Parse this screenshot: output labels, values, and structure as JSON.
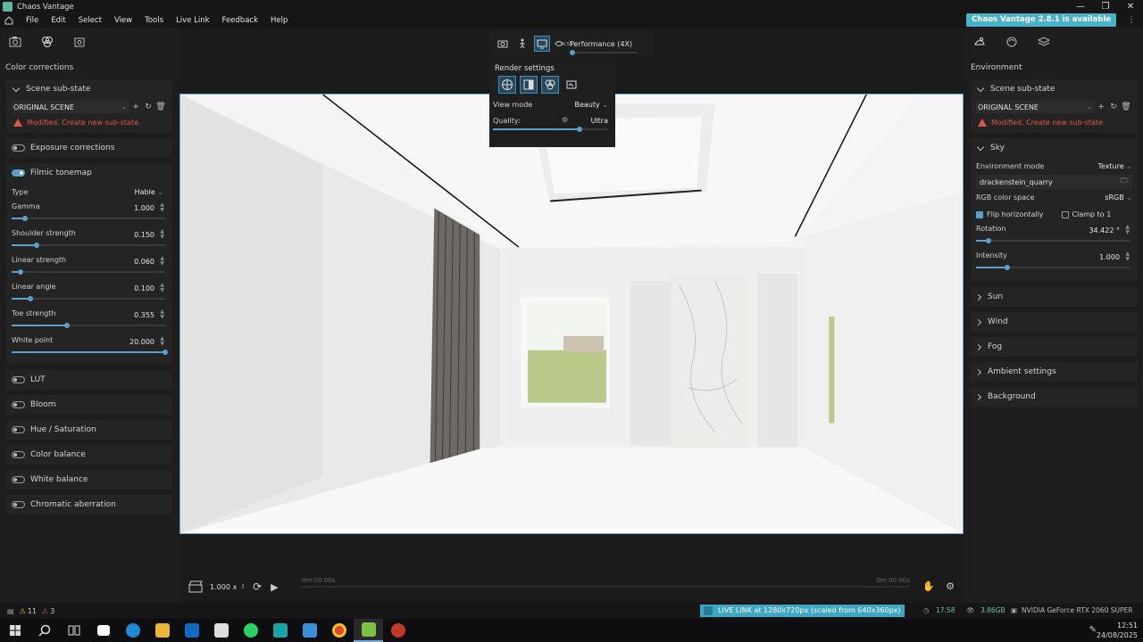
{
  "window": {
    "title": "Chaos Vantage"
  },
  "menu": {
    "items": [
      "File",
      "Edit",
      "Select",
      "View",
      "Tools",
      "Live Link",
      "Feedback",
      "Help"
    ],
    "update_badge": "Chaos Vantage 2.8.1 is available"
  },
  "left_panel": {
    "heading": "Color corrections",
    "scene_substate": {
      "title": "Scene sub-state",
      "selected": "ORIGINAL SCENE",
      "warning": "Modified. Create new sub-state."
    },
    "exposure": {
      "label": "Exposure corrections",
      "enabled": false
    },
    "tonemap": {
      "label": "Filmic tonemap",
      "enabled": true,
      "type_label": "Type",
      "type_value": "Hable",
      "params": [
        {
          "label": "Gamma",
          "value": "1.000",
          "level": 0.09
        },
        {
          "label": "Shoulder strength",
          "value": "0.150",
          "level": 0.16
        },
        {
          "label": "Linear strength",
          "value": "0.060",
          "level": 0.06
        },
        {
          "label": "Linear angle",
          "value": "0.100",
          "level": 0.12
        },
        {
          "label": "Toe strength",
          "value": "0.355",
          "level": 0.36
        },
        {
          "label": "White point",
          "value": "20.000",
          "level": 1.0
        }
      ]
    },
    "sections": [
      "LUT",
      "Bloom",
      "Hue / Saturation",
      "Color balance",
      "White balance",
      "Chromatic aberration"
    ]
  },
  "toolbar": {
    "performance": "Performance (4X)",
    "performance_level": 0.0,
    "dlss": "DLSS"
  },
  "render_settings": {
    "title": "Render settings",
    "view_mode_label": "View mode",
    "view_mode_value": "Beauty",
    "quality_label": "Quality:",
    "quality_value": "Ultra",
    "quality_level": 0.75
  },
  "right_panel": {
    "heading": "Environment",
    "scene_substate": {
      "title": "Scene sub-state",
      "selected": "ORIGINAL SCENE",
      "warning": "Modified. Create new sub-state."
    },
    "sky": {
      "title": "Sky",
      "env_mode_label": "Environment mode",
      "env_mode_value": "Texture",
      "texture_file": "drackenstein_quarry",
      "rgb_label": "RGB color space",
      "rgb_value": "sRGB",
      "flip_label": "Flip horizontally",
      "flip_checked": true,
      "clamp_label": "Clamp to 1",
      "clamp_checked": false,
      "rotation_label": "Rotation",
      "rotation_value": "34.422 °",
      "rotation_level": 0.08,
      "intensity_label": "Intensity",
      "intensity_value": "1.000",
      "intensity_level": 0.2
    },
    "sections": [
      "Sun",
      "Wind",
      "Fog",
      "Ambient settings",
      "Background"
    ]
  },
  "timeline": {
    "speed": "1.000 x",
    "start_time": "0m:00.00s",
    "end_time": "0m:00.00s"
  },
  "status": {
    "warnings": "11",
    "errors": "3",
    "live_link": "LIVE LINK at 1280x720px (scaled from 640x360px)",
    "fps": "17.58",
    "vram": "3.86GB",
    "gpu": "NVIDIA GeForce RTX 2060 SUPER"
  },
  "taskbar": {
    "time": "12:51",
    "date": "24/08/2025"
  },
  "colors": {
    "accent": "#5aa0c9",
    "warning": "#e0564b",
    "badge": "#49b2c9"
  }
}
